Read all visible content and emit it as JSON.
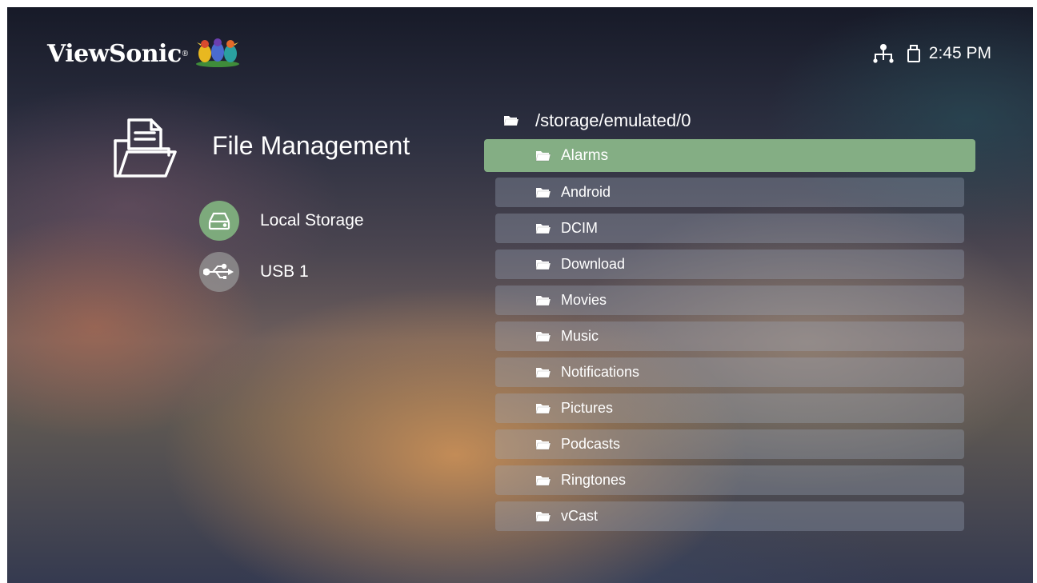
{
  "header": {
    "brand": "ViewSonic",
    "brand_reg": "®",
    "time": "2:45 PM",
    "status_icons": [
      "network-icon",
      "usb-drive-icon"
    ]
  },
  "sidebar": {
    "title": "File Management",
    "sources": [
      {
        "label": "Local Storage",
        "icon": "hard-drive-icon",
        "selected": true
      },
      {
        "label": "USB 1",
        "icon": "usb-icon",
        "selected": false
      }
    ]
  },
  "browser": {
    "path": "/storage/emulated/0",
    "selected": "Alarms",
    "folders": [
      "Android",
      "DCIM",
      "Download",
      "Movies",
      "Music",
      "Notifications",
      "Pictures",
      "Podcasts",
      "Ringtones",
      "vCast"
    ]
  },
  "colors": {
    "accent_green": "#84ae84",
    "text": "#ffffff"
  }
}
